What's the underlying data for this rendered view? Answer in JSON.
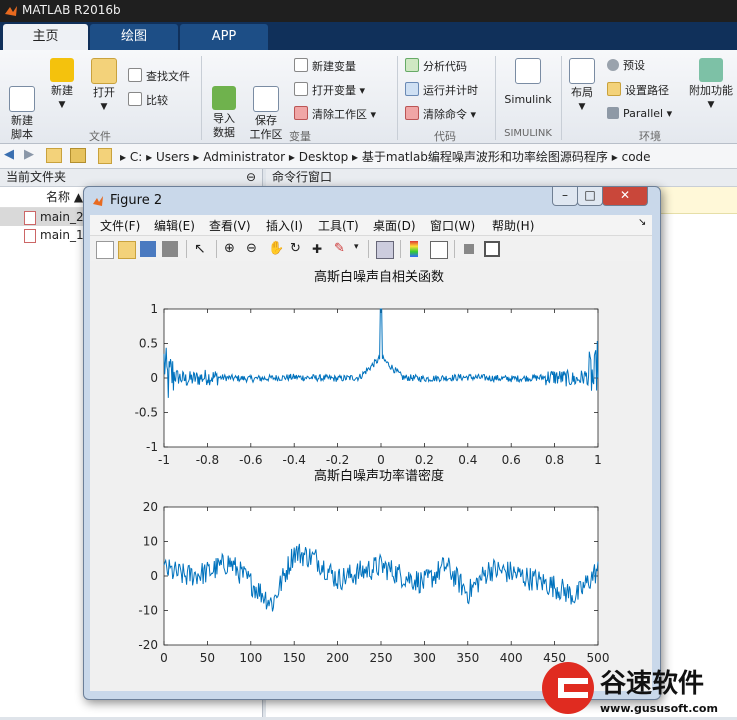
{
  "app": {
    "title": "MATLAB R2016b"
  },
  "tabs": [
    {
      "label": "主页"
    },
    {
      "label": "绘图"
    },
    {
      "label": "APP"
    }
  ],
  "ribbon": {
    "file": {
      "section": "文件",
      "new_script": "新建\n脚本",
      "new": "新建",
      "open": "打开",
      "find_files": "查找文件",
      "compare": "比较"
    },
    "variable": {
      "section": "变量",
      "import": "导入\n数据",
      "save_ws": "保存\n工作区",
      "new_var": "新建变量",
      "open_var": "打开变量",
      "clear_ws": "清除工作区"
    },
    "code": {
      "section": "代码",
      "analyze": "分析代码",
      "run_time": "运行并计时",
      "clear_cmd": "清除命令"
    },
    "simulink": {
      "section": "SIMULINK",
      "label": "Simulink"
    },
    "env": {
      "section": "环境",
      "layout": "布局",
      "prefs": "预设",
      "set_path": "设置路径",
      "parallel": "Parallel",
      "addons": "附加功能"
    }
  },
  "address": {
    "crumbs": [
      "C:",
      "Users",
      "Administrator",
      "Desktop",
      "基于matlab编程噪声波形和功率绘图源码程序",
      "code"
    ]
  },
  "left_panel": {
    "title": "当前文件夹",
    "col_name": "名称 ▲",
    "files": [
      "main_2.m",
      "main_1.m"
    ]
  },
  "right_panel": {
    "title": "命令行窗口"
  },
  "figure": {
    "title": "Figure 2",
    "menu": [
      "文件(F)",
      "编辑(E)",
      "查看(V)",
      "插入(I)",
      "工具(T)",
      "桌面(D)",
      "窗口(W)",
      "帮助(H)"
    ],
    "toolbar_icons": [
      "new-figure-icon",
      "open-icon",
      "save-icon",
      "print-icon",
      "pointer-icon",
      "zoom-in-icon",
      "zoom-out-icon",
      "pan-icon",
      "rotate-icon",
      "data-cursor-icon",
      "brush-icon",
      "link-icon",
      "colorbar-icon",
      "legend-icon",
      "hide-plot-tools-icon",
      "show-plot-tools-icon"
    ]
  },
  "chart_data": [
    {
      "type": "line",
      "title": "高斯白噪声自相关函数",
      "xlabel": "",
      "ylabel": "",
      "xlim": [
        -1,
        1
      ],
      "ylim": [
        -1,
        1
      ],
      "xticks": [
        "-1",
        "-0.8",
        "-0.6",
        "-0.4",
        "-0.2",
        "0",
        "0.2",
        "0.4",
        "0.6",
        "0.8",
        "1"
      ],
      "yticks": [
        "-1",
        "-0.5",
        "0",
        "0.5",
        "1"
      ],
      "series": [
        {
          "color": "#0072BD",
          "x": [
            -1,
            -0.99,
            -0.98,
            -0.97,
            -0.95,
            -0.9,
            -0.8,
            -0.6,
            -0.4,
            -0.2,
            -0.1,
            0,
            0.1,
            0.2,
            0.4,
            0.6,
            0.8,
            0.9,
            0.95,
            0.97,
            0.98,
            0.99,
            1
          ],
          "y": [
            0.8,
            0.3,
            -0.2,
            0.15,
            0.1,
            -0.08,
            0.05,
            -0.04,
            0.04,
            -0.03,
            0.03,
            1,
            0.03,
            -0.03,
            0.04,
            -0.04,
            0.05,
            -0.08,
            0.1,
            0.15,
            -0.25,
            0.35,
            0.9
          ]
        }
      ]
    },
    {
      "type": "line",
      "title": "高斯白噪声功率谱密度",
      "xlabel": "",
      "ylabel": "",
      "xlim": [
        0,
        500
      ],
      "ylim": [
        -20,
        20
      ],
      "xticks": [
        "0",
        "50",
        "100",
        "150",
        "200",
        "250",
        "300",
        "350",
        "400",
        "450",
        "500"
      ],
      "yticks": [
        "-20",
        "-10",
        "0",
        "10",
        "20"
      ],
      "series": [
        {
          "color": "#0072BD",
          "x": [
            0,
            25,
            50,
            75,
            100,
            125,
            150,
            175,
            200,
            225,
            250,
            275,
            300,
            325,
            350,
            375,
            400,
            425,
            450,
            475,
            500
          ],
          "y": [
            2,
            0,
            1,
            4,
            -2,
            -8,
            7,
            5,
            -1,
            1,
            3,
            0,
            -2,
            3,
            -5,
            2,
            1,
            -1,
            -3,
            -6,
            2
          ]
        }
      ]
    }
  ]
}
